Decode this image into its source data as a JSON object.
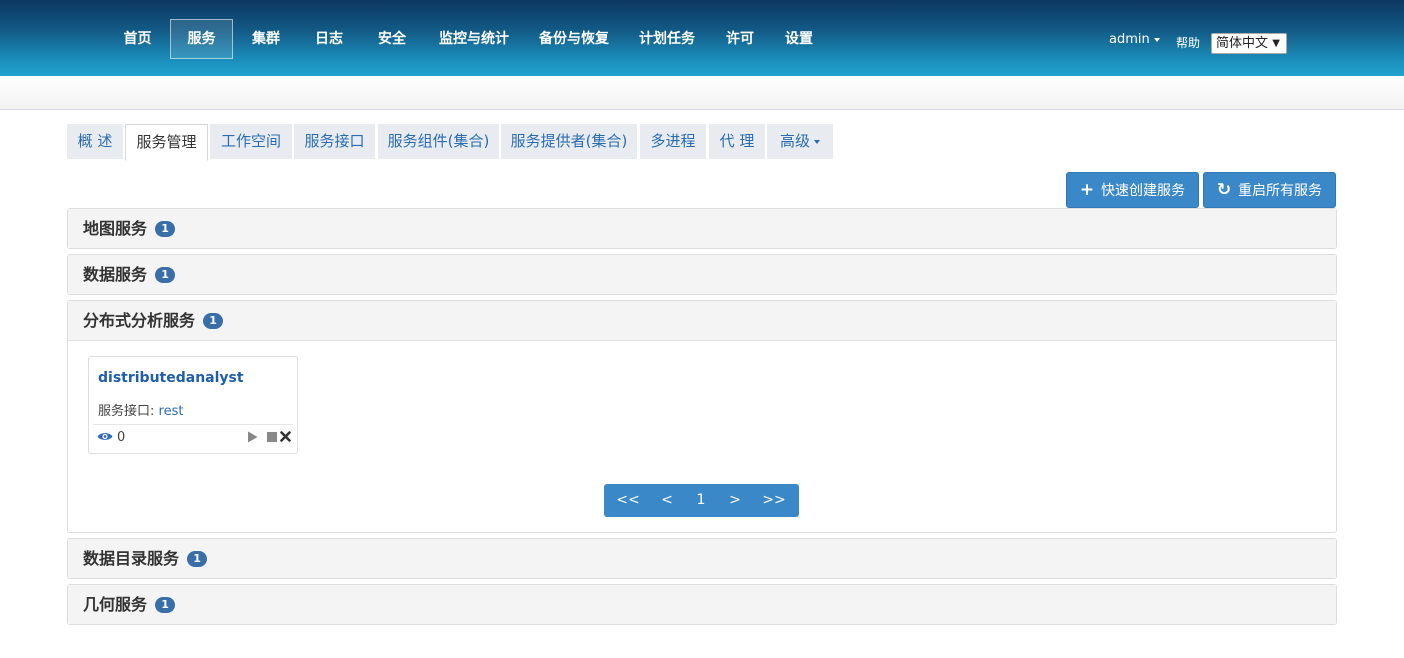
{
  "nav": {
    "items": [
      "首页",
      "服务",
      "集群",
      "日志",
      "安全",
      "监控与统计",
      "备份与恢复",
      "计划任务",
      "许可",
      "设置"
    ],
    "active": "服务",
    "user": "admin",
    "help": "帮助",
    "language": "简体中文"
  },
  "tabs": [
    "概 述",
    "服务管理",
    "工作空间",
    "服务接口",
    "服务组件(集合)",
    "服务提供者(集合)",
    "多进程",
    "代 理",
    "高级"
  ],
  "actions": {
    "create": "快速创建服务",
    "restart": "重启所有服务"
  },
  "panels": [
    {
      "title": "地图服务",
      "count": "1"
    },
    {
      "title": "数据服务",
      "count": "1"
    },
    {
      "title": "分布式分析服务",
      "count": "1"
    },
    {
      "title": "数据目录服务",
      "count": "1"
    },
    {
      "title": "几何服务",
      "count": "1"
    }
  ],
  "card": {
    "name": "distributedanalyst",
    "interface_label": "服务接口:",
    "interface_value": "rest",
    "views": "0"
  },
  "pager": {
    "first": "<<",
    "prev": "<",
    "page": "1",
    "next": ">",
    "last": ">>"
  },
  "colors": {
    "accent": "#3b88c9",
    "badge": "#3a6ea8",
    "link": "#2b6cb0"
  },
  "icons": [
    "plus-icon",
    "refresh-icon",
    "eye-icon",
    "play-icon",
    "stop-icon",
    "delete-icon",
    "caret-down-icon"
  ]
}
